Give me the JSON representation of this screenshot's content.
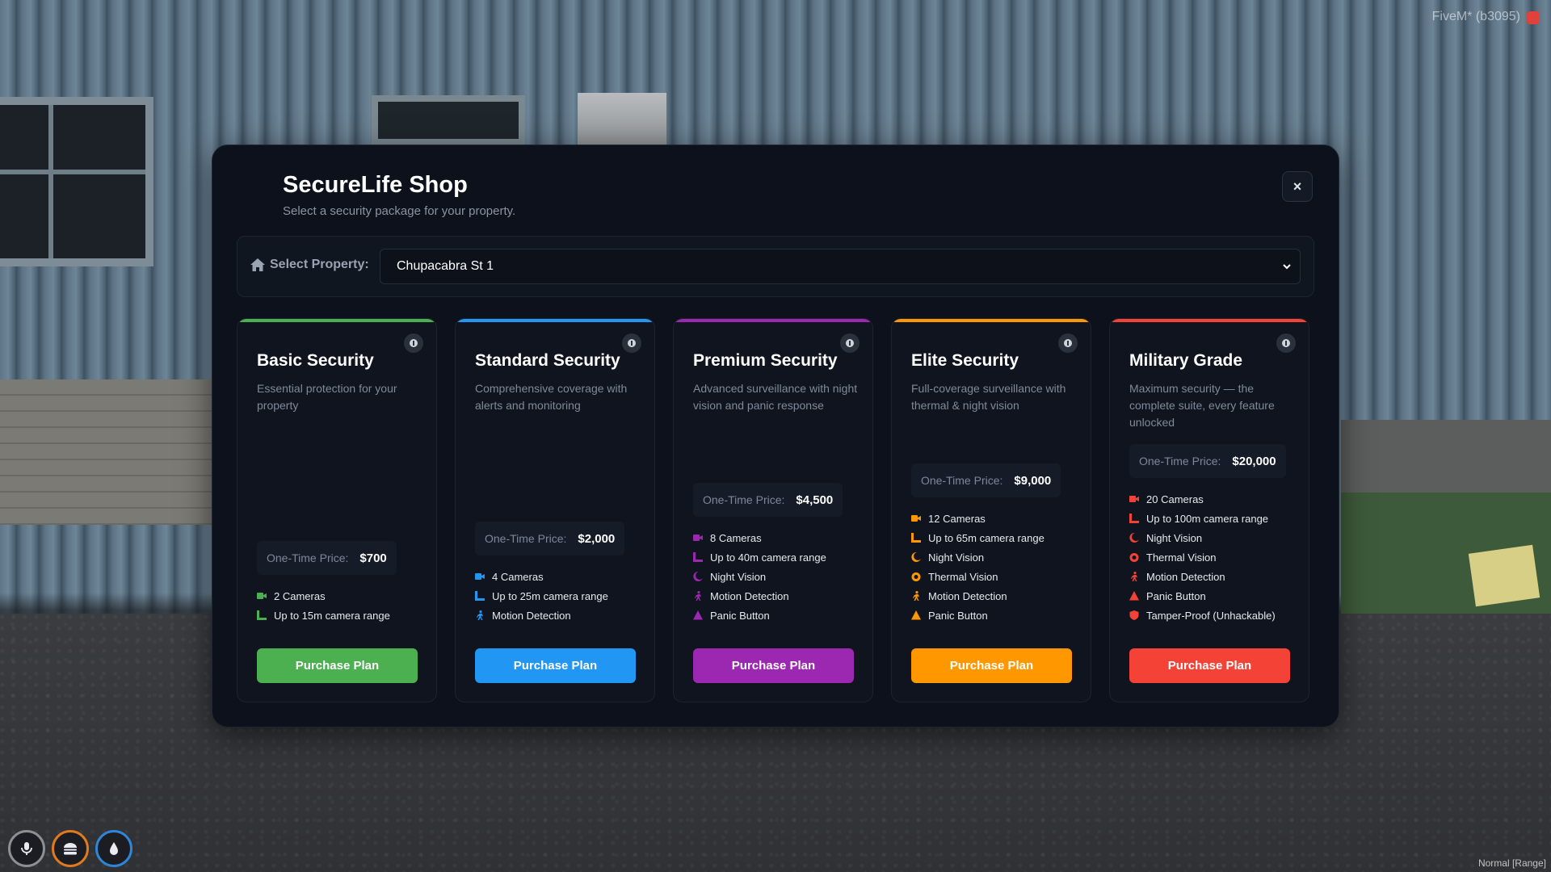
{
  "watermark": "FiveM* (b3095)",
  "mode_text": "Normal [Range]",
  "modal": {
    "title": "SecureLife Shop",
    "subtitle": "Select a security package for your property.",
    "close_label": "×"
  },
  "property": {
    "label": "Select Property:",
    "selected": "Chupacabra St 1"
  },
  "colors": {
    "basic": "#4caf50",
    "standard": "#2196f3",
    "premium": "#9c27b0",
    "elite": "#ff9800",
    "military": "#f44336"
  },
  "cards": [
    {
      "title": "Basic Security",
      "description": "Essential protection for your property",
      "price_label": "One-Time Price:",
      "price": "$700",
      "features": [
        {
          "icon": "camera-icon",
          "text": "2 Cameras"
        },
        {
          "icon": "range-icon",
          "text": "Up to 15m camera range"
        }
      ],
      "button": "Purchase Plan"
    },
    {
      "title": "Standard Security",
      "description": "Comprehensive coverage with alerts and monitoring",
      "price_label": "One-Time Price:",
      "price": "$2,000",
      "features": [
        {
          "icon": "camera-icon",
          "text": "4 Cameras"
        },
        {
          "icon": "range-icon",
          "text": "Up to 25m camera range"
        },
        {
          "icon": "motion-icon",
          "text": "Motion Detection"
        }
      ],
      "button": "Purchase Plan"
    },
    {
      "title": "Premium Security",
      "description": "Advanced surveillance with night vision and panic response",
      "price_label": "One-Time Price:",
      "price": "$4,500",
      "features": [
        {
          "icon": "camera-icon",
          "text": "8 Cameras"
        },
        {
          "icon": "range-icon",
          "text": "Up to 40m camera range"
        },
        {
          "icon": "moon-icon",
          "text": "Night Vision"
        },
        {
          "icon": "motion-icon",
          "text": "Motion Detection"
        },
        {
          "icon": "warning-icon",
          "text": "Panic Button"
        }
      ],
      "button": "Purchase Plan"
    },
    {
      "title": "Elite Security",
      "description": "Full-coverage surveillance with thermal & night vision",
      "price_label": "One-Time Price:",
      "price": "$9,000",
      "features": [
        {
          "icon": "camera-icon",
          "text": "12 Cameras"
        },
        {
          "icon": "range-icon",
          "text": "Up to 65m camera range"
        },
        {
          "icon": "moon-icon",
          "text": "Night Vision"
        },
        {
          "icon": "thermal-icon",
          "text": "Thermal Vision"
        },
        {
          "icon": "motion-icon",
          "text": "Motion Detection"
        },
        {
          "icon": "warning-icon",
          "text": "Panic Button"
        }
      ],
      "button": "Purchase Plan"
    },
    {
      "title": "Military Grade",
      "description": "Maximum security — the complete suite, every feature unlocked",
      "price_label": "One-Time Price:",
      "price": "$20,000",
      "features": [
        {
          "icon": "camera-icon",
          "text": "20 Cameras"
        },
        {
          "icon": "range-icon",
          "text": "Up to 100m camera range"
        },
        {
          "icon": "moon-icon",
          "text": "Night Vision"
        },
        {
          "icon": "thermal-icon",
          "text": "Thermal Vision"
        },
        {
          "icon": "motion-icon",
          "text": "Motion Detection"
        },
        {
          "icon": "warning-icon",
          "text": "Panic Button"
        },
        {
          "icon": "shield-icon",
          "text": "Tamper-Proof (Unhackable)"
        }
      ],
      "button": "Purchase Plan"
    }
  ]
}
